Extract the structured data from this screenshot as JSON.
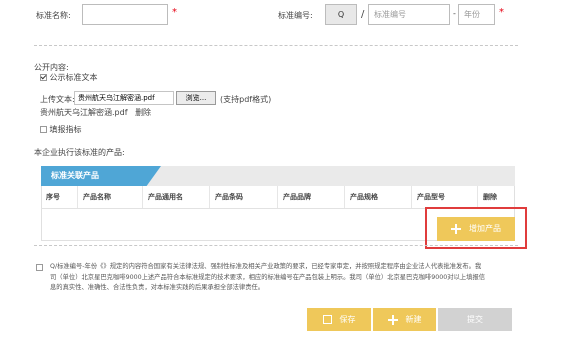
{
  "form": {
    "standard_name_label": "标准名称:",
    "standard_no_label": "标准编号:",
    "prefix_value": "Q",
    "separator_slash": "/",
    "standard_no_placeholder": "标准编号",
    "separator_dash": "-",
    "year_placeholder": "年份",
    "required_mark": "*"
  },
  "public": {
    "title": "公开内容:",
    "publish_text_label": "公示标准文本",
    "publish_text_checked": true,
    "upload_label": "上传文本:",
    "file_value": "贵州航天乌江解密涵.pdf",
    "browse_label": "浏览...",
    "pdf_hint": "(支持pdf格式)",
    "uploaded_file": "贵州航天乌江解密涵.pdf",
    "delete_label": "删除",
    "indicator_label": "填报指标",
    "indicator_checked": false
  },
  "products": {
    "title": "本企业执行该标准的产品:",
    "tab_label": "标准关联产品",
    "columns": [
      "序号",
      "产品名称",
      "产品通用名",
      "产品条码",
      "产品品牌",
      "产品规格",
      "产品型号",
      "删除"
    ],
    "add_button": "增加产品"
  },
  "declaration": {
    "checked": false,
    "line1": "Q/标准编号-年份《》规定的内容符合国家有关法律法规、强制性标准及相关产业政策的要求，已经专家审定，并按照规定程序由企业法人代表批准发布。我",
    "line2": "司（单位）北京星巴克咖啡9000上述产品符合本标准规定的技术要求，相应的标准编号在产品包装上明示。我司（单位）北京星巴克咖啡9000对以上填报信",
    "line3": "息的真实性、准确性、合法性负责，对本标准实践的后果承担全部法律责任。"
  },
  "actions": {
    "save_label": "保存",
    "new_label": "新建",
    "submit_label": "提交"
  },
  "colors": {
    "accent_blue": "#4fa6d6",
    "button_yellow": "#efc85a",
    "highlight_red": "#e03c3c",
    "required_red": "#e60012"
  }
}
